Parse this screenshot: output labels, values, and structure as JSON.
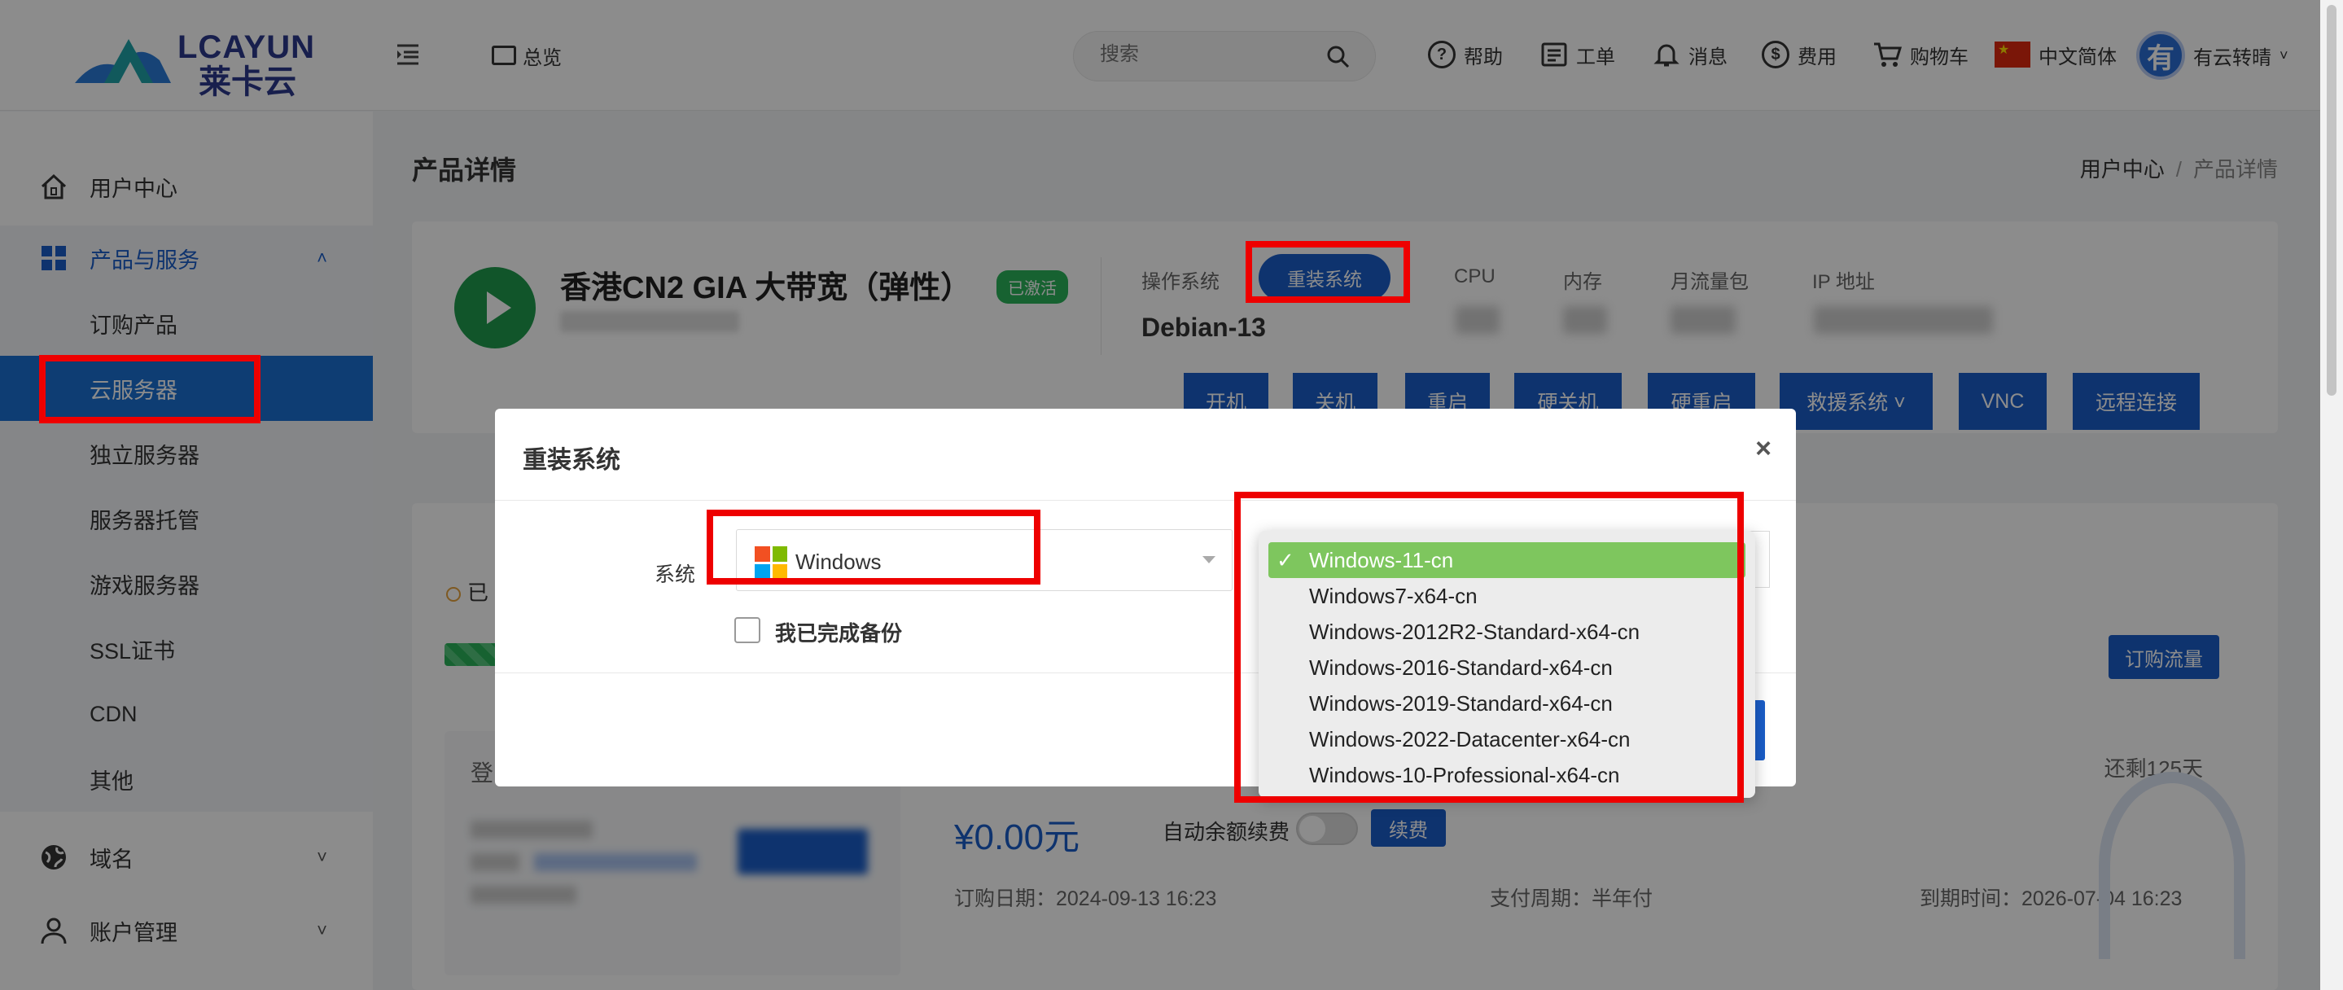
{
  "header": {
    "logo_text": "LCAYUN",
    "logo_sub": "莱卡云",
    "overview": "总览",
    "search_placeholder": "搜索",
    "nav": [
      {
        "label": "帮助",
        "icon": "help-circle-icon"
      },
      {
        "label": "工单",
        "icon": "ticket-icon"
      },
      {
        "label": "消息",
        "icon": "bell-icon"
      },
      {
        "label": "费用",
        "icon": "dollar-icon"
      },
      {
        "label": "购物车",
        "icon": "cart-icon"
      },
      {
        "label": "中文简体",
        "icon": "china-flag-icon"
      }
    ],
    "avatar_letter": "有",
    "username": "有云转晴"
  },
  "sidebar": {
    "items": [
      {
        "label": "用户中心",
        "icon": "home-icon"
      },
      {
        "label": "产品与服务",
        "icon": "grid-icon"
      },
      {
        "label": "订购产品"
      },
      {
        "label": "云服务器"
      },
      {
        "label": "独立服务器"
      },
      {
        "label": "服务器托管"
      },
      {
        "label": "游戏服务器"
      },
      {
        "label": "SSL证书"
      },
      {
        "label": "CDN"
      },
      {
        "label": "其他"
      },
      {
        "label": "域名",
        "icon": "globe-icon"
      },
      {
        "label": "账户管理",
        "icon": "user-icon"
      }
    ]
  },
  "page": {
    "title": "产品详情",
    "breadcrumb": [
      "用户中心",
      "/",
      "产品详情"
    ]
  },
  "product": {
    "name": "香港CN2 GIA 大带宽（弹性）",
    "status": "已激活",
    "os_label": "操作系统",
    "reinstall_button": "重装系统",
    "os_value": "Debian-13",
    "specs": [
      "CPU",
      "内存",
      "月流量包",
      "IP 地址"
    ],
    "actions": [
      "开机",
      "关机",
      "重启",
      "硬关机",
      "硬重启",
      "救援系统 ˅",
      "VNC",
      "远程连接"
    ]
  },
  "usage": {
    "used_prefix": "已",
    "buy_traffic": "订购流量",
    "login_title": "登",
    "price": "¥0.00元",
    "auto_renew": "自动余额续费",
    "renew_button": "续费",
    "remaining": "还剩125天",
    "order_date": "订购日期：2024-09-13 16:23",
    "pay_cycle": "支付周期：半年付",
    "expire": "到期时间：2026-07-04 16:23"
  },
  "modal": {
    "title": "重装系统",
    "close": "×",
    "system_label": "系统",
    "os_selected": "Windows",
    "backup_label": "我已完成备份",
    "versions": [
      "Windows-11-cn",
      "Windows7-x64-cn",
      "Windows-2012R2-Standard-x64-cn",
      "Windows-2016-Standard-x64-cn",
      "Windows-2019-Standard-x64-cn",
      "Windows-2022-Datacenter-x64-cn",
      "Windows-10-Professional-x64-cn"
    ],
    "selected_mark": "✓"
  },
  "colors": {
    "primary": "#1a5dc8",
    "sidebar_active": "#1a6fd1",
    "active_badge": "#2bb25a",
    "dropdown_selected": "#7ec65e",
    "annotation": "#ee0000"
  }
}
